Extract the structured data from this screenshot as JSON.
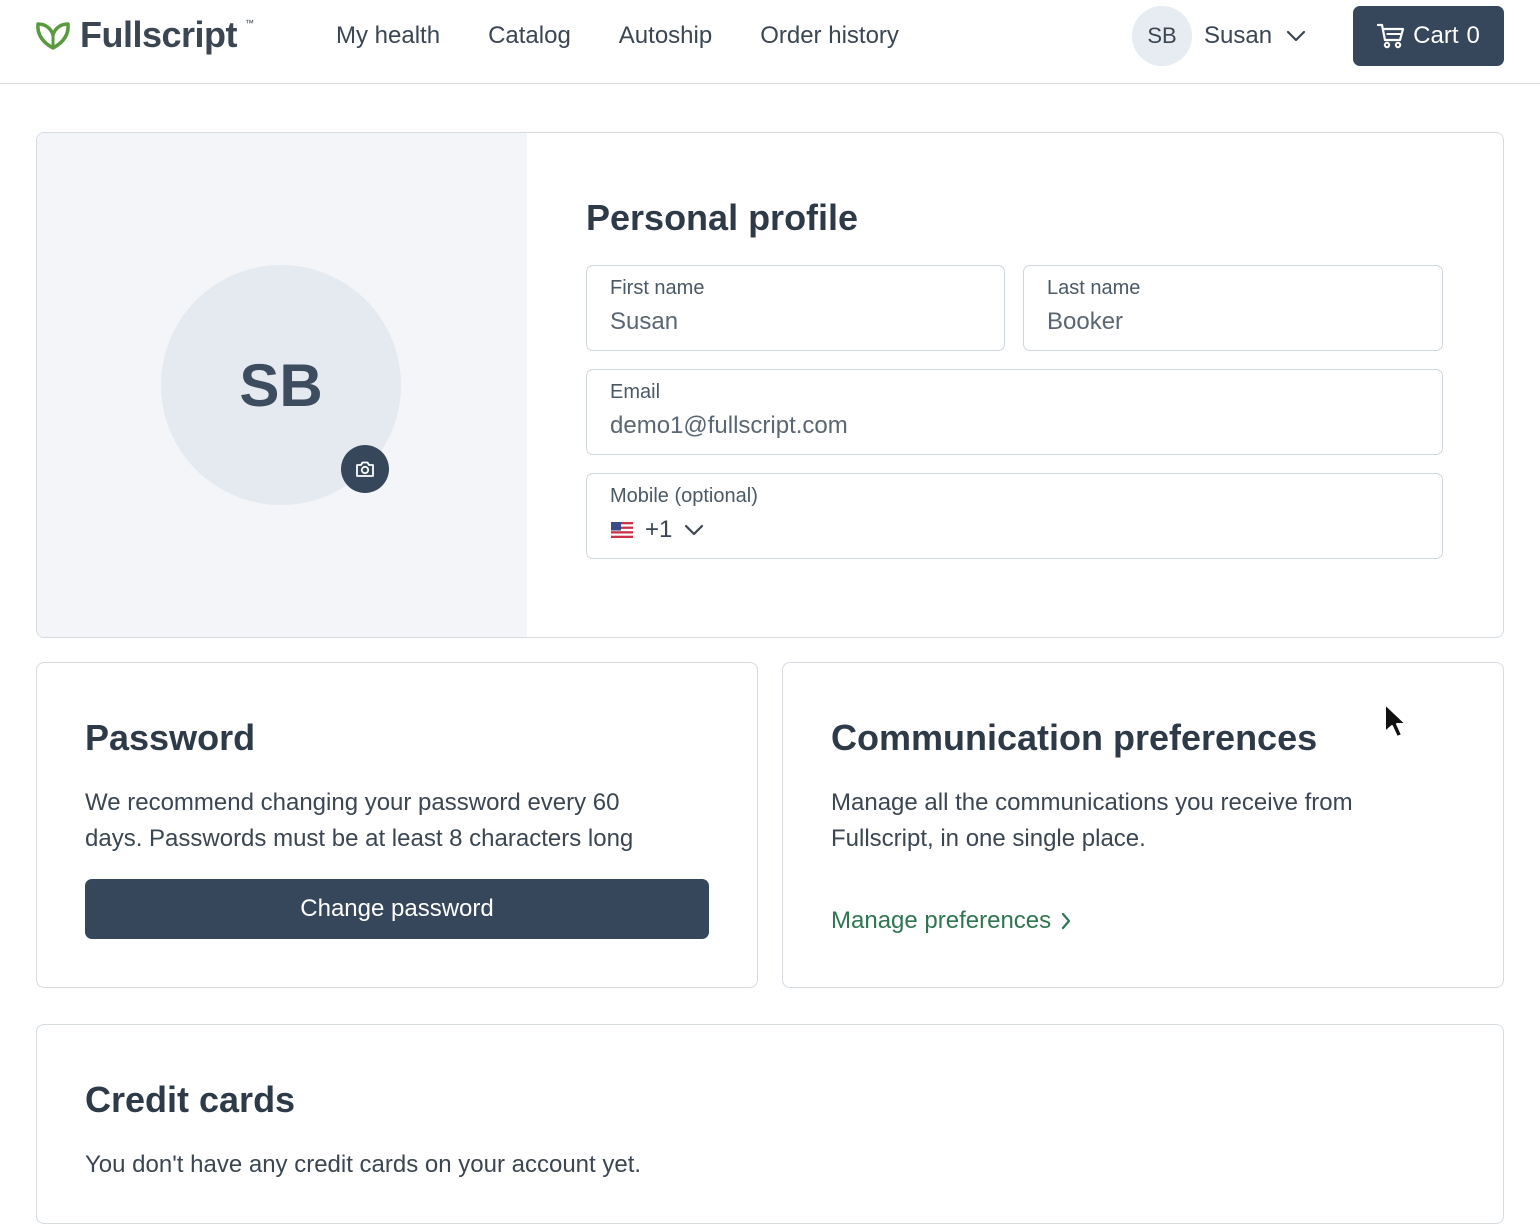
{
  "header": {
    "logo_text": "Fullscript",
    "logo_tm": "™",
    "nav": [
      "My health",
      "Catalog",
      "Autoship",
      "Order history"
    ],
    "user": {
      "initials": "SB",
      "name": "Susan"
    },
    "cart": {
      "label": "Cart",
      "count": "0"
    }
  },
  "profile": {
    "title": "Personal profile",
    "avatar_initials": "SB",
    "first_name": {
      "label": "First name",
      "value": "Susan"
    },
    "last_name": {
      "label": "Last name",
      "value": "Booker"
    },
    "email": {
      "label": "Email",
      "value": "demo1@fullscript.com"
    },
    "mobile": {
      "label": "Mobile (optional)",
      "dial_code": "+1",
      "country_flag": "us-flag-icon"
    }
  },
  "password": {
    "title": "Password",
    "line1": "We recommend changing your password every 60",
    "line2": "days. Passwords must be at least 8 characters long",
    "button": "Change password"
  },
  "communication": {
    "title": "Communication preferences",
    "line1": "Manage all the communications you receive from",
    "line2": "Fullscript, in one single place.",
    "link": "Manage preferences"
  },
  "credit_cards": {
    "title": "Credit cards",
    "empty_text": "You don't have any credit cards on your account yet."
  },
  "colors": {
    "primary": "#36475b",
    "link_green": "#2f7650",
    "logo_green": "#5a9a3e",
    "panel_bg": "#f3f5f8"
  }
}
